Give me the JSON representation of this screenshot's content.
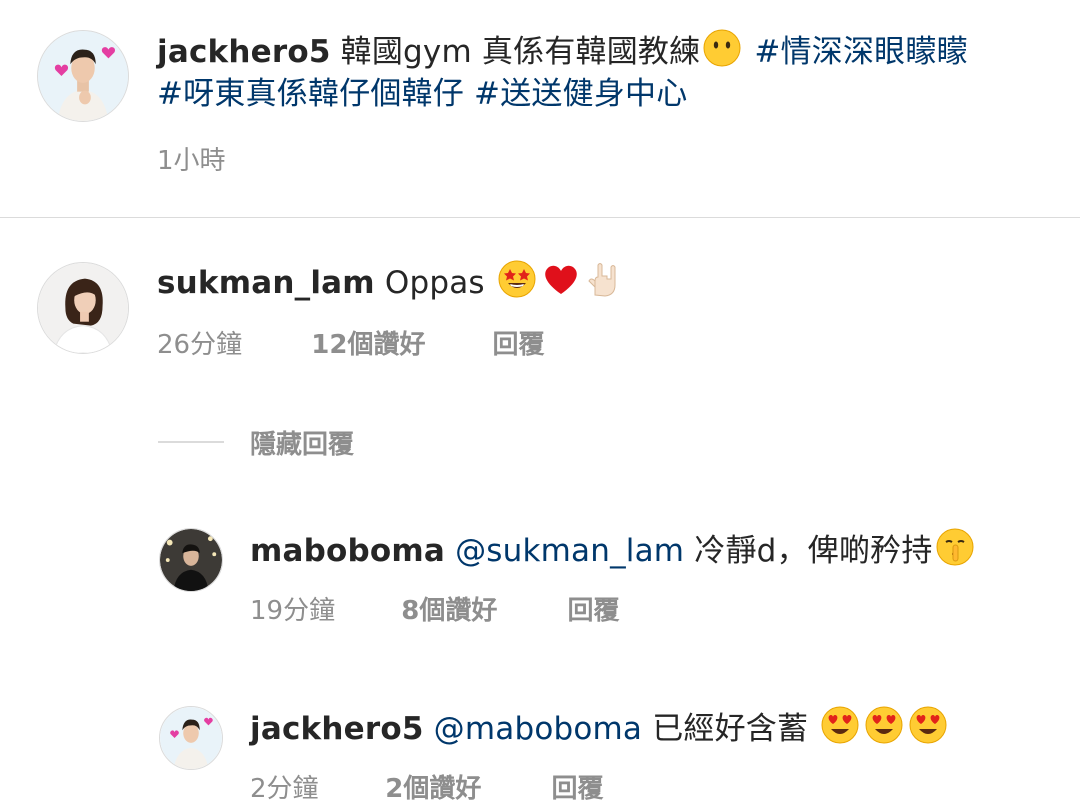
{
  "post": {
    "username": "jackhero5",
    "caption": "韓國gym 真係有韓國教練",
    "hashtags": [
      "#情深深眼矇矇",
      "#呀東真係韓仔個韓仔",
      "#送送健身中心"
    ],
    "time": "1小時",
    "emoji": "no-mouth-face-icon"
  },
  "comments": [
    {
      "username": "sukman_lam",
      "text": "Oppas",
      "emojis": [
        "star-struck-face-icon",
        "red-heart-icon",
        "rock-on-hand-icon"
      ],
      "time": "26分鐘",
      "likes": "12個讚好",
      "reply_label": "回覆"
    }
  ],
  "hide_replies_label": "隱藏回覆",
  "replies": [
    {
      "username": "maboboma",
      "mention": "@sukman_lam",
      "text": "冷靜d，俾啲矜持",
      "emojis": [
        "shushing-face-icon"
      ],
      "time": "19分鐘",
      "likes": "8個讚好",
      "reply_label": "回覆"
    },
    {
      "username": "jackhero5",
      "mention": "@maboboma",
      "text": "已經好含蓄",
      "emojis": [
        "heart-eyes-face-icon",
        "heart-eyes-face-icon",
        "heart-eyes-face-icon"
      ],
      "time": "2分鐘",
      "likes": "2個讚好",
      "reply_label": "回覆"
    }
  ],
  "colors": {
    "hashtag": "#00376b",
    "meta": "#8e8e8e",
    "divider": "#dbdbdb"
  }
}
